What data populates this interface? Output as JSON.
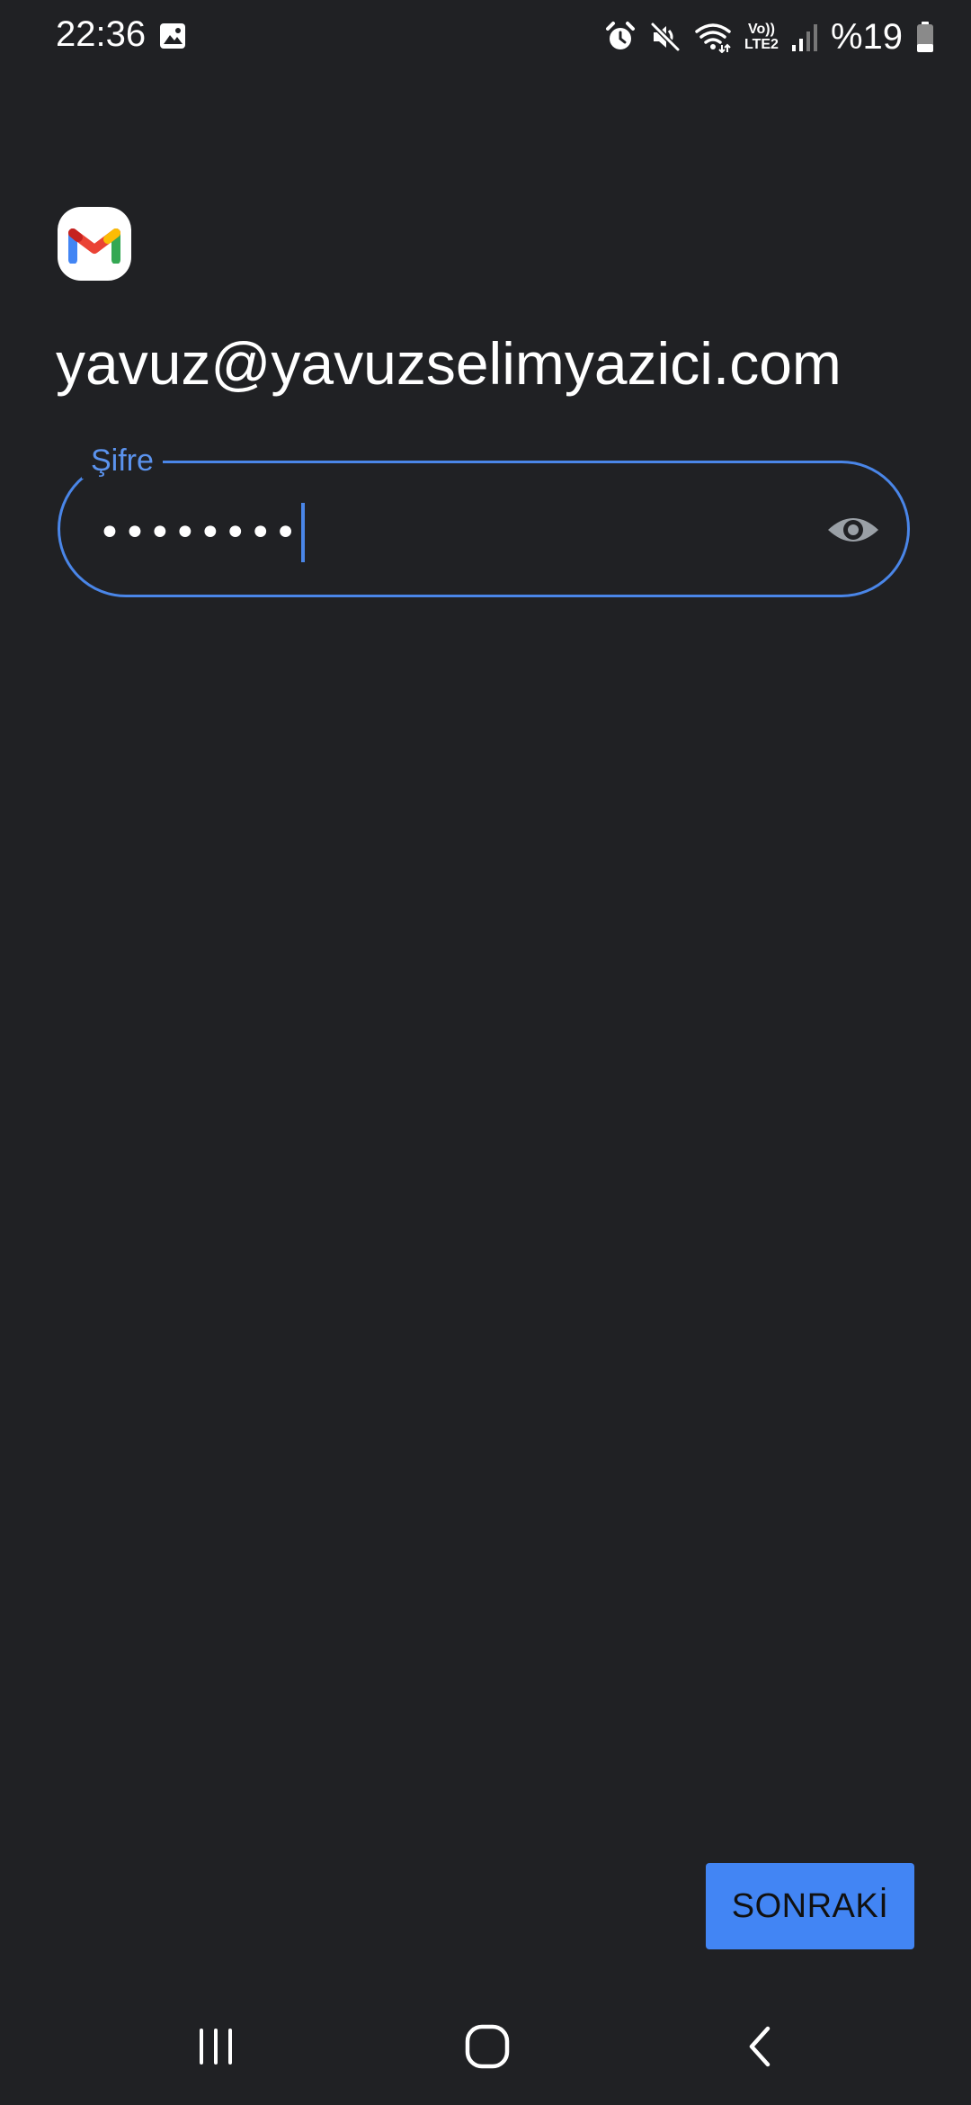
{
  "status_bar": {
    "time": "22:36",
    "lte_line1": "Vo))",
    "lte_line2": "LTE2",
    "battery": "%19",
    "icons": [
      "gallery-icon",
      "alarm-icon",
      "mute-icon",
      "wifi-icon",
      "lte-icon",
      "signal-icon",
      "battery-icon"
    ]
  },
  "app": {
    "logo": "gmail-logo",
    "colors": {
      "background": "#202124",
      "accent": "#4285f4",
      "field_border": "#4a86e8"
    }
  },
  "account": {
    "email": "yavuz@yavuzselimyazici.com"
  },
  "password": {
    "label": "Şifre",
    "masked_value": "••••••••",
    "toggle_icon": "eye-icon"
  },
  "actions": {
    "next_label": "SONRAKİ"
  },
  "nav_bar": {
    "items": [
      "recents-icon",
      "home-icon",
      "back-icon"
    ]
  }
}
